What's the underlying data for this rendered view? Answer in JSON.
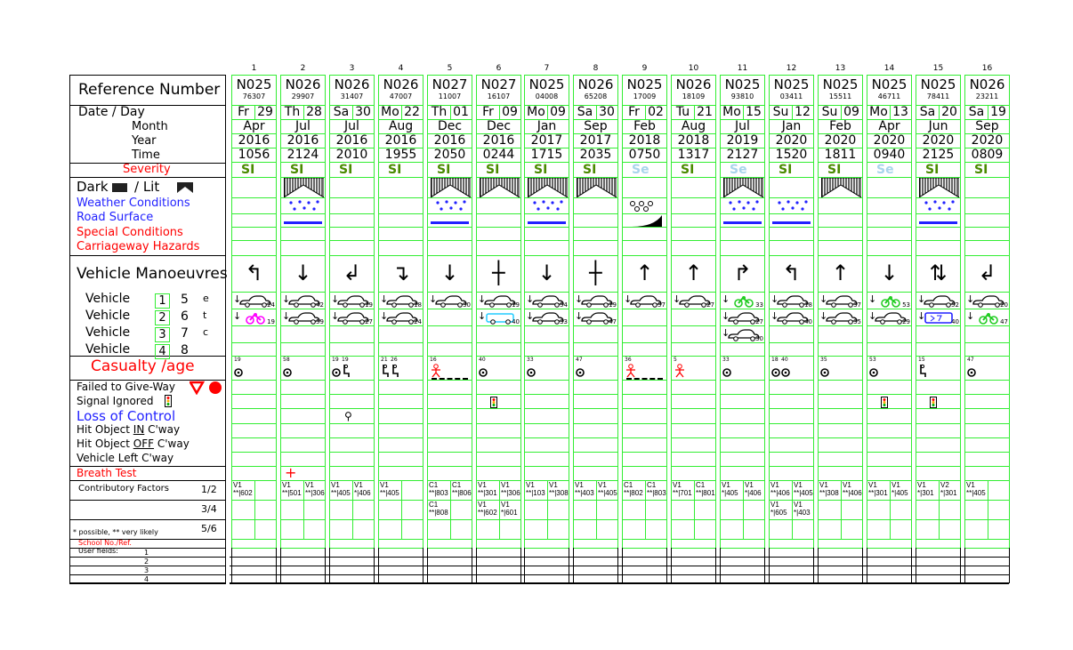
{
  "labels": {
    "reference_number": "Reference Number",
    "date_day": "Date / Day",
    "month": "Month",
    "year": "Year",
    "time": "Time",
    "severity": "Severity",
    "dark": "Dark",
    "lit": "/ Lit",
    "weather": "Weather Conditions",
    "road_surface": "Road Surface",
    "special": "Special Conditions",
    "hazards": "Carriageway Hazards",
    "manoeuvres": "Vehicle Manoeuvres",
    "vehicle": "Vehicle",
    "vehicle_numbers": [
      "1",
      "2",
      "3",
      "4",
      "5",
      "6",
      "7",
      "8"
    ],
    "etc": [
      "e",
      "t",
      "c"
    ],
    "casualty": "Casualty /age",
    "failed_give_way": "Failed to Give-Way",
    "signal_ignored": "Signal Ignored",
    "loss_of_control": "Loss of Control",
    "hit_in_pre": "Hit Object ",
    "hit_in_u": "IN",
    "hit_in_post": " C'way",
    "hit_off_pre": "Hit Object ",
    "hit_off_u": "OFF",
    "hit_off_post": " C'way",
    "left_cway": "Vehicle Left C'way",
    "breath_test": "Breath Test",
    "contributory": "Contributory Factors",
    "cf_12": "1/2",
    "cf_34": "3/4",
    "cf_56": "5/6",
    "possible_note": "* possible, ** very likely",
    "school": "School No./Ref.",
    "user_fields": "User fields:",
    "user_nums": [
      "1",
      "2",
      "3",
      "4"
    ]
  },
  "colors": {
    "grid": "#33ee33",
    "serious": "#4a8a00",
    "slight": "#a8d4ec",
    "red": "#ff0000",
    "blue": "#2222ff"
  },
  "columns": [
    {
      "n": "1",
      "ref": "N025",
      "sub": "76307",
      "day": "Fr",
      "date": "29",
      "month": "Apr",
      "year": "2016",
      "time": "1056",
      "severity": "SI",
      "light": "",
      "weather": "",
      "surface": "",
      "manoeuvre": "↰",
      "vehicles": [
        {
          "type": "car",
          "num": "24"
        },
        {
          "type": "motorcycle",
          "num": "19"
        }
      ],
      "casualties": [
        {
          "age": "19",
          "type": "occupant"
        }
      ],
      "signal": false,
      "loc": false,
      "breath": false,
      "cf": [
        "V1 **|602"
      ]
    },
    {
      "n": "2",
      "ref": "N026",
      "sub": "29907",
      "day": "Th",
      "date": "28",
      "month": "Jul",
      "year": "2016",
      "time": "2124",
      "severity": "SI",
      "light": "lit",
      "weather": "rain",
      "surface": "wet",
      "manoeuvre": "↓",
      "vehicles": [
        {
          "type": "car",
          "num": "42"
        },
        {
          "type": "car",
          "num": "59"
        }
      ],
      "casualties": [
        {
          "age": "58",
          "type": "occupant"
        }
      ],
      "signal": false,
      "loc": false,
      "breath": true,
      "cf": [
        "V1 **|501",
        "V1 **|306"
      ]
    },
    {
      "n": "3",
      "ref": "N026",
      "sub": "31407",
      "day": "Sa",
      "date": "30",
      "month": "Jul",
      "year": "2016",
      "time": "2010",
      "severity": "SI",
      "light": "",
      "weather": "",
      "surface": "",
      "manoeuvre": "↲",
      "vehicles": [
        {
          "type": "car",
          "num": "19"
        },
        {
          "type": "car",
          "num": "27"
        }
      ],
      "casualties": [
        {
          "age": "19",
          "type": "occupant"
        },
        {
          "age": "19",
          "type": "seat"
        }
      ],
      "signal": false,
      "loc": true,
      "breath": false,
      "cf": [
        "V1 **|405",
        "V1 *|406"
      ]
    },
    {
      "n": "4",
      "ref": "N026",
      "sub": "47007",
      "day": "Mo",
      "date": "22",
      "month": "Aug",
      "year": "2016",
      "time": "1955",
      "severity": "SI",
      "light": "",
      "weather": "",
      "surface": "",
      "manoeuvre": "↴",
      "vehicles": [
        {
          "type": "car",
          "num": "18"
        },
        {
          "type": "car",
          "num": "24"
        }
      ],
      "casualties": [
        {
          "age": "21",
          "type": "seat"
        },
        {
          "age": "26",
          "type": "seat"
        }
      ],
      "signal": false,
      "loc": false,
      "breath": false,
      "cf": [
        "V1 **|405"
      ]
    },
    {
      "n": "5",
      "ref": "N027",
      "sub": "11007",
      "day": "Th",
      "date": "01",
      "month": "Dec",
      "year": "2016",
      "time": "2050",
      "severity": "SI",
      "light": "lit",
      "weather": "rain",
      "surface": "wet",
      "manoeuvre": "↓",
      "vehicles": [
        {
          "type": "car",
          "num": "30"
        }
      ],
      "casualties": [
        {
          "age": "16",
          "type": "pedestrian"
        }
      ],
      "signal": false,
      "loc": false,
      "breath": false,
      "cf": [
        "C1 **|803",
        "C1 **|806",
        "C1 **|808"
      ]
    },
    {
      "n": "6",
      "ref": "N027",
      "sub": "16107",
      "day": "Fr",
      "date": "09",
      "month": "Dec",
      "year": "2016",
      "time": "0244",
      "severity": "SI",
      "light": "lit",
      "weather": "",
      "surface": "",
      "manoeuvre": "┼",
      "vehicles": [
        {
          "type": "car",
          "num": "19"
        },
        {
          "type": "van",
          "num": "40"
        }
      ],
      "casualties": [
        {
          "age": "40",
          "type": "occupant"
        }
      ],
      "signal": true,
      "loc": false,
      "breath": false,
      "cf": [
        "V1 **|301",
        "V1 **|306",
        "V1 **|602",
        "V1 *|601"
      ]
    },
    {
      "n": "7",
      "ref": "N025",
      "sub": "04008",
      "day": "Mo",
      "date": "09",
      "month": "Jan",
      "year": "2017",
      "time": "1715",
      "severity": "SI",
      "light": "lit",
      "weather": "rain",
      "surface": "wet",
      "manoeuvre": "↓",
      "vehicles": [
        {
          "type": "car",
          "num": "54"
        },
        {
          "type": "car",
          "num": "33"
        }
      ],
      "casualties": [
        {
          "age": "33",
          "type": "occupant"
        }
      ],
      "signal": false,
      "loc": false,
      "breath": false,
      "cf": [
        "V1 **|103",
        "V1 **|308"
      ]
    },
    {
      "n": "8",
      "ref": "N026",
      "sub": "65208",
      "day": "Sa",
      "date": "30",
      "month": "Sep",
      "year": "2017",
      "time": "2035",
      "severity": "SI",
      "light": "lit",
      "weather": "",
      "surface": "",
      "manoeuvre": "┼",
      "vehicles": [
        {
          "type": "car",
          "num": "19"
        },
        {
          "type": "car",
          "num": "47"
        }
      ],
      "casualties": [
        {
          "age": "47",
          "type": "occupant"
        }
      ],
      "signal": false,
      "loc": false,
      "breath": false,
      "cf": [
        "V1 **|403",
        "V1 **|405"
      ]
    },
    {
      "n": "9",
      "ref": "N025",
      "sub": "17009",
      "day": "Fr",
      "date": "02",
      "month": "Feb",
      "year": "2018",
      "time": "0750",
      "severity": "Se",
      "light": "",
      "weather": "fog",
      "surface": "ice",
      "manoeuvre": "↑",
      "vehicles": [
        {
          "type": "car",
          "num": "57"
        }
      ],
      "casualties": [
        {
          "age": "36",
          "type": "pedestrian"
        }
      ],
      "signal": false,
      "loc": false,
      "breath": false,
      "cf": [
        "C1 **|802",
        "C1 **|803"
      ]
    },
    {
      "n": "10",
      "ref": "N026",
      "sub": "18109",
      "day": "Tu",
      "date": "21",
      "month": "Aug",
      "year": "2018",
      "time": "1317",
      "severity": "SI",
      "light": "",
      "weather": "",
      "surface": "",
      "manoeuvre": "↑",
      "vehicles": [
        {
          "type": "car",
          "num": "27"
        }
      ],
      "casualties": [
        {
          "age": "5",
          "type": "child-pedestrian"
        }
      ],
      "signal": false,
      "loc": false,
      "breath": false,
      "cf": [
        "V1 **|701",
        "C1 **|801"
      ]
    },
    {
      "n": "11",
      "ref": "N025",
      "sub": "93810",
      "day": "Mo",
      "date": "15",
      "month": "Jul",
      "year": "2019",
      "time": "2127",
      "severity": "Se",
      "light": "lit",
      "weather": "rain",
      "surface": "wet",
      "manoeuvre": "↱",
      "vehicles": [
        {
          "type": "bicycle",
          "num": "33"
        },
        {
          "type": "car",
          "num": "27"
        },
        {
          "type": "car",
          "num": "30"
        }
      ],
      "casualties": [
        {
          "age": "33",
          "type": "occupant"
        }
      ],
      "signal": false,
      "loc": false,
      "breath": false,
      "cf": [
        "V1 *|405",
        "V1 *|406"
      ]
    },
    {
      "n": "12",
      "ref": "N025",
      "sub": "03411",
      "day": "Su",
      "date": "12",
      "month": "Jan",
      "year": "2020",
      "time": "1520",
      "severity": "SI",
      "light": "",
      "weather": "rain",
      "surface": "wet",
      "manoeuvre": "↰",
      "vehicles": [
        {
          "type": "car",
          "num": "18"
        },
        {
          "type": "car",
          "num": "40"
        }
      ],
      "casualties": [
        {
          "age": "18",
          "type": "occupant"
        },
        {
          "age": "40",
          "type": "occupant"
        }
      ],
      "signal": false,
      "loc": false,
      "breath": false,
      "cf": [
        "V1 **|406",
        "V1 **|405",
        "V1 *|605",
        "V1 *|403"
      ]
    },
    {
      "n": "13",
      "ref": "N025",
      "sub": "15511",
      "day": "Su",
      "date": "09",
      "month": "Feb",
      "year": "2020",
      "time": "1811",
      "severity": "SI",
      "light": "lit",
      "weather": "",
      "surface": "",
      "manoeuvre": "↑",
      "vehicles": [
        {
          "type": "car",
          "num": "37"
        },
        {
          "type": "car",
          "num": "35"
        }
      ],
      "casualties": [
        {
          "age": "35",
          "type": "occupant"
        }
      ],
      "signal": false,
      "loc": false,
      "breath": false,
      "cf": [
        "V1 **|308",
        "V1 **|406"
      ]
    },
    {
      "n": "14",
      "ref": "N025",
      "sub": "46711",
      "day": "Mo",
      "date": "13",
      "month": "Apr",
      "year": "2020",
      "time": "0940",
      "severity": "Se",
      "light": "",
      "weather": "",
      "surface": "",
      "manoeuvre": "↓",
      "vehicles": [
        {
          "type": "bicycle",
          "num": "53"
        },
        {
          "type": "car",
          "num": "29"
        }
      ],
      "casualties": [
        {
          "age": "53",
          "type": "occupant"
        }
      ],
      "signal": true,
      "loc": false,
      "breath": false,
      "cf": [
        "V1 **|301",
        "V1 *|405"
      ]
    },
    {
      "n": "15",
      "ref": "N025",
      "sub": "78411",
      "day": "Sa",
      "date": "20",
      "month": "Jun",
      "year": "2020",
      "time": "2125",
      "severity": "SI",
      "light": "lit",
      "weather": "rain",
      "surface": "wet",
      "manoeuvre": "⇅",
      "vehicles": [
        {
          "type": "car",
          "num": "52"
        },
        {
          "type": "bus",
          "num": "40"
        }
      ],
      "casualties": [
        {
          "age": "15",
          "type": "seat"
        }
      ],
      "signal": true,
      "loc": false,
      "breath": false,
      "cf": [
        "V1 *|301",
        "V2 *|301"
      ]
    },
    {
      "n": "16",
      "ref": "N026",
      "sub": "23211",
      "day": "Sa",
      "date": "19",
      "month": "Sep",
      "year": "2020",
      "time": "0809",
      "severity": "SI",
      "light": "",
      "weather": "",
      "surface": "",
      "manoeuvre": "↲",
      "vehicles": [
        {
          "type": "car",
          "num": "20"
        },
        {
          "type": "bicycle",
          "num": "47"
        }
      ],
      "casualties": [
        {
          "age": "47",
          "type": "occupant"
        }
      ],
      "signal": false,
      "loc": false,
      "breath": false,
      "cf": [
        "V1 **|405"
      ]
    }
  ]
}
